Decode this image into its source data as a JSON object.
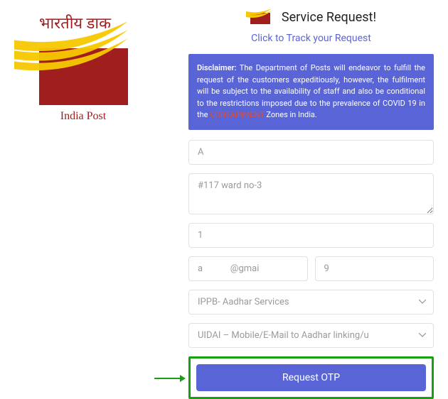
{
  "brand": {
    "name_hi": "भारतीय डाक",
    "name_en": "India Post"
  },
  "header": {
    "title": "Service Request!",
    "track_link": "Click to Track your Request"
  },
  "disclaimer": {
    "label": "Disclaimer:",
    "text_before": " The Department of Posts will endeavor to fulfill the request of the customers expeditiously, however, the fulfilment will be subject to the availability of staff and also be conditional to the restrictions imposed due to the prevalence of COVID 19 in the ",
    "containment": "CONTAINMENT",
    "text_after": " Zones in India."
  },
  "form": {
    "name": "A",
    "address": "#117 ward no-3",
    "pincode": "1",
    "email": "a            @gmai",
    "mobile": "9",
    "service": "IPPB- Aadhar Services",
    "subservice": "UIDAI – Mobile/E-Mail to Aadhar linking/u",
    "submit_label": "Request OTP"
  }
}
